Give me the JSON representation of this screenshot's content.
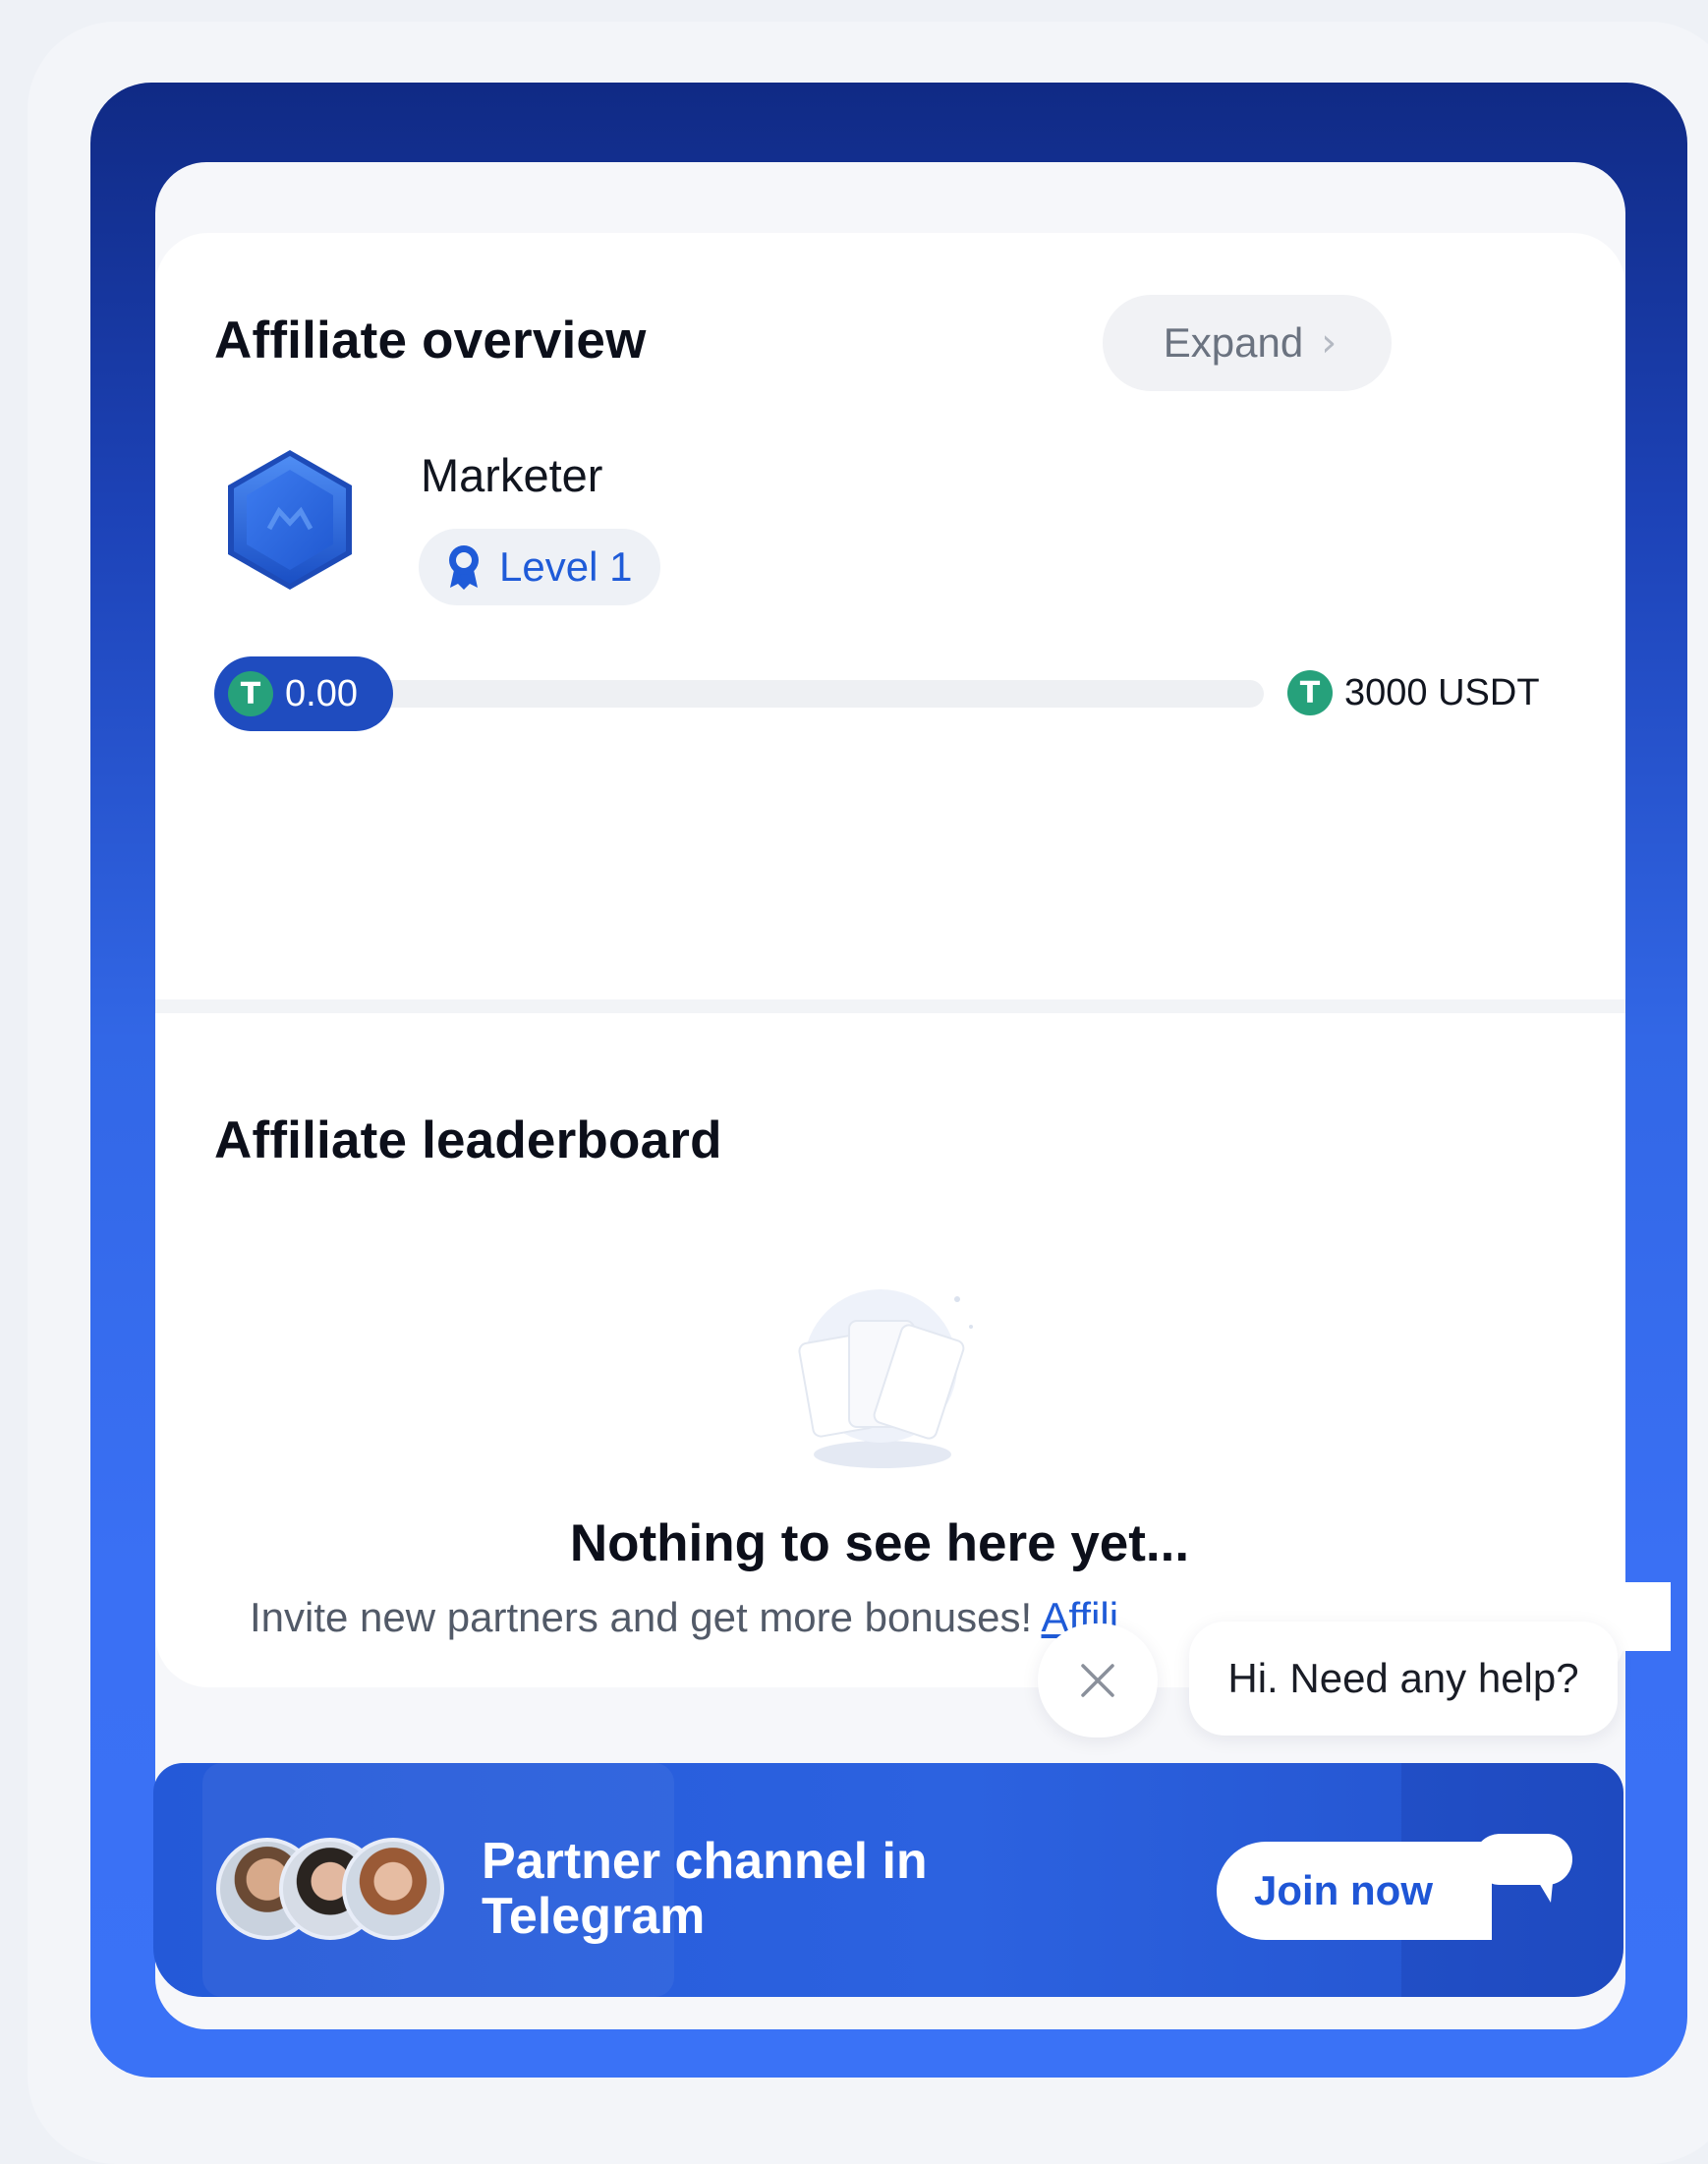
{
  "overview": {
    "title": "Affiliate overview",
    "expand_label": "Expand",
    "role": "Marketer",
    "level": "Level 1",
    "progress": {
      "current": "0.00",
      "target": "3000 USDT",
      "fraction": 0.0
    }
  },
  "leaderboard": {
    "title": "Affiliate leaderboard",
    "empty_title": "Nothing to see here yet...",
    "empty_text": "Invite new partners and get more bonuses! ",
    "empty_link": "Affili"
  },
  "chat": {
    "greeting": "Hi. Need any help?"
  },
  "banner": {
    "title": "Partner channel in Telegram",
    "join_label": "Join now"
  },
  "colors": {
    "accent": "#1f5bd8",
    "usdt": "#26a17b",
    "frame_top": "#102a85",
    "frame_bottom": "#3a72f6"
  },
  "icons": {
    "expand": "chevron-right-icon",
    "level": "award-ribbon-icon",
    "currency": "usdt-icon",
    "close": "close-icon",
    "chat": "chat-bubble-icon"
  }
}
